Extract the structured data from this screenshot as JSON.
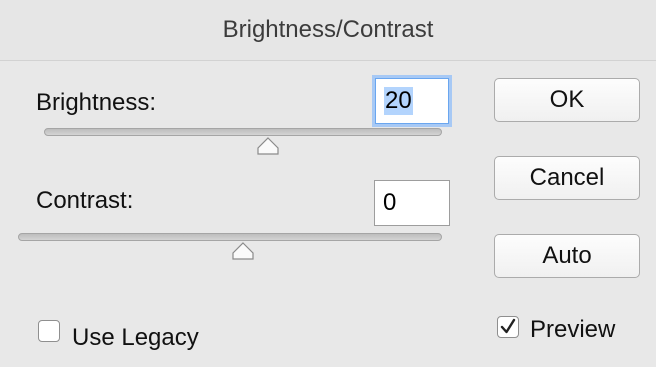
{
  "window": {
    "title": "Brightness/Contrast"
  },
  "brightness": {
    "label": "Brightness:",
    "value": "20",
    "slider_value": 20
  },
  "contrast": {
    "label": "Contrast:",
    "value": "0",
    "slider_value": 0
  },
  "buttons": {
    "ok": "OK",
    "cancel": "Cancel",
    "auto": "Auto"
  },
  "use_legacy": {
    "label": "Use Legacy",
    "checked": false
  },
  "preview": {
    "label": "Preview",
    "checked": true
  },
  "icons": {
    "slider_thumb": "triangle-thumb-icon",
    "checkmark": "checkmark-icon"
  },
  "colors": {
    "focus_ring": "#a7c9f5",
    "selection": "#b3d4fd"
  }
}
